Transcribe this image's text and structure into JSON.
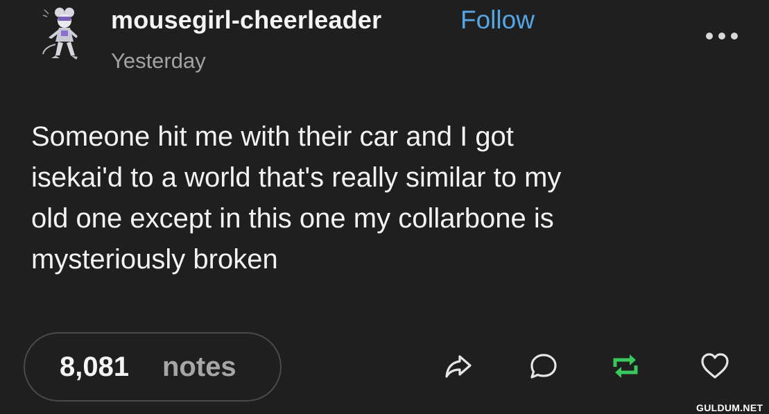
{
  "post": {
    "username": "mousegirl-cheerleader",
    "follow_label": "Follow",
    "timestamp": "Yesterday",
    "text_lines": [
      "Someone hit me with their car and I got",
      "isekai'd to a world that's really similar to my",
      "old one except in this one my collarbone is",
      "mysteriously broken"
    ],
    "notes_count": "8,081",
    "notes_label": "notes"
  },
  "icons": {
    "more": "more-options-icon",
    "share": "share-icon",
    "reply": "reply-icon",
    "reblog": "reblog-icon",
    "like": "heart-icon"
  },
  "colors": {
    "background": "#1f1f1f",
    "follow": "#55a6e6",
    "reblog": "#37c95c",
    "muted": "#a3a3a3"
  },
  "watermark": "GULDUM.NET"
}
